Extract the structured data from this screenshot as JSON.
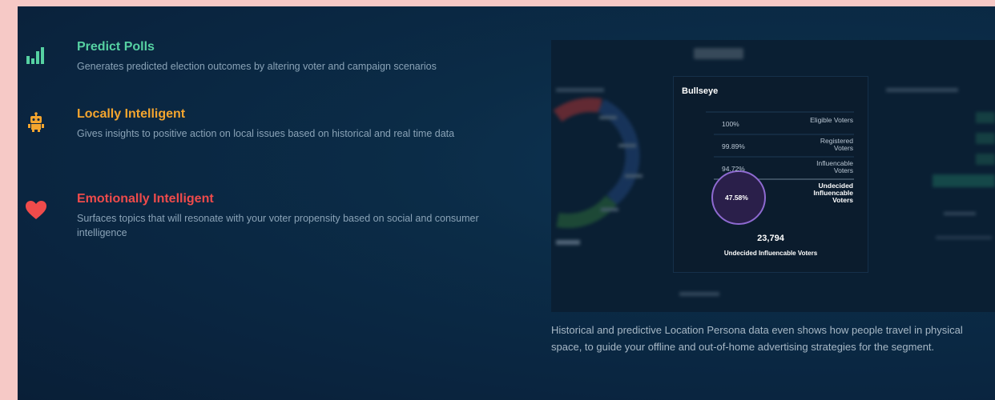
{
  "features": [
    {
      "title": "Predict Polls",
      "description": "Generates predicted election outcomes by altering voter and campaign scenarios",
      "icon": "bar-chart-icon",
      "color": "#56d1a2"
    },
    {
      "title": "Locally Intelligent",
      "description": "Gives insights to positive action on local issues based on historical and real time data",
      "icon": "robot-icon",
      "color": "#f4a52e"
    },
    {
      "title": "Emotionally Intelligent",
      "description": "Surfaces topics that will resonate with your voter propensity based on social and consumer intelligence",
      "icon": "heart-icon",
      "color": "#ef4b4b"
    }
  ],
  "dashboard": {
    "card_title": "Bullseye",
    "rows": [
      {
        "pct": "100%",
        "label": "Eligible Voters"
      },
      {
        "pct": "99.89%",
        "label": "Registered Voters"
      },
      {
        "pct": "94.72%",
        "label": "Influencable Voters"
      },
      {
        "pct": "47.58%",
        "label": "Undecided Influencable Voters"
      }
    ],
    "total": "23,794",
    "total_label": "Undecided Influencable Voters"
  },
  "caption": "Historical and predictive Location Persona data even shows how people travel in physical space, to guide your offline and out-of-home advertising strategies for the segment."
}
